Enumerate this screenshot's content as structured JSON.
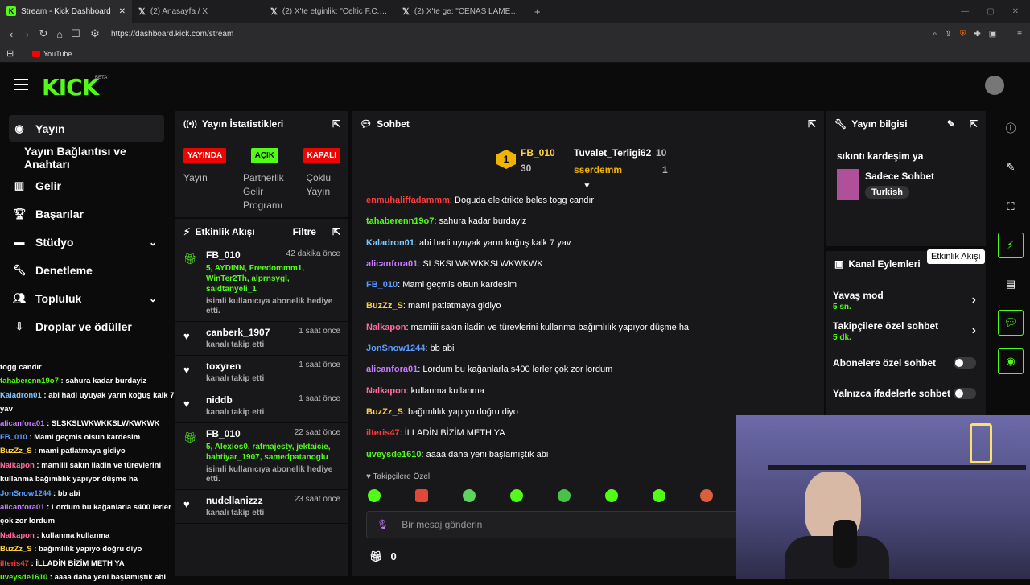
{
  "browser": {
    "tabs": [
      {
        "title": "Stream - Kick Dashboard",
        "icon": "kick-logo-icon"
      },
      {
        "title": "(2) Anasayfa / X",
        "icon": "x-logo-icon"
      },
      {
        "title": "(2) X'te etginlik: \"Celtic F.C. stadyum...",
        "icon": "x-logo-icon"
      },
      {
        "title": "(2) X'te ge: \"CENAS LAMENTAVEIS! P...",
        "icon": "x-logo-icon"
      }
    ],
    "url": "https://dashboard.kick.com/stream",
    "bookmark": "YouTube"
  },
  "app": {
    "logo": "KICK",
    "beta": "BETA"
  },
  "sidebar": {
    "items": [
      {
        "label": "Yayın",
        "icon": "broadcast-icon"
      },
      {
        "label": "Yayın Bağlantısı ve Anahtarı"
      },
      {
        "label": "Gelir",
        "icon": "chart-icon"
      },
      {
        "label": "Başarılar",
        "icon": "trophy-icon"
      },
      {
        "label": "Stüdyo",
        "icon": "studio-icon"
      },
      {
        "label": "Denetleme",
        "icon": "wrench-icon"
      },
      {
        "label": "Topluluk",
        "icon": "community-icon"
      },
      {
        "label": "Droplar ve ödüller",
        "icon": "drops-icon"
      }
    ]
  },
  "overlay_chat": [
    {
      "user": "",
      "text": "togg candır",
      "color": "#ffffff"
    },
    {
      "user": "tahaberenn19o7",
      "text": " : sahura kadar burdayiz",
      "color": "#53fc18"
    },
    {
      "user": "Kaladron01",
      "text": " : abi hadi uyuyak yarın koğuş kalk 7",
      "color": "#7ec8ff"
    },
    {
      "user": "",
      "text": "yav",
      "color": "#ffffff"
    },
    {
      "user": "alicanfora01",
      "text": " : SLSKSLWKWKKSLWKWKWK",
      "color": "#c77dff"
    },
    {
      "user": "FB_010",
      "text": " : Mami geçmis olsun kardesim",
      "color": "#5b9cff"
    },
    {
      "user": "BuzZz_S",
      "text": " : mami patlatmaya gidiyo",
      "color": "#ffd23f"
    },
    {
      "user": "Nalkapon",
      "text": " : mamiiii sakın iladin ve türevlerini",
      "color": "#ff6b9d"
    },
    {
      "user": "",
      "text": "kullanma bağımlılık yapıyor düşme ha",
      "color": "#ffffff"
    },
    {
      "user": "JonSnow1244",
      "text": " : bb abi",
      "color": "#5b9cff"
    },
    {
      "user": "alicanfora01",
      "text": " : Lordum bu kağanlarla s400 lerler",
      "color": "#c77dff"
    },
    {
      "user": "",
      "text": "çok zor lordum",
      "color": "#ffffff"
    },
    {
      "user": "Nalkapon",
      "text": " : kullanma kullanma",
      "color": "#ff6b9d"
    },
    {
      "user": "BuzZz_S",
      "text": " : bağımlılık yapıyo doğru diyo",
      "color": "#ffd23f"
    },
    {
      "user": "ilteris47",
      "text": " : İLLADİN BİZİM METH YA",
      "color": "#ff3b3b"
    },
    {
      "user": "uveysde1610",
      "text": " : aaaa daha yeni başlamıştık abi",
      "color": "#53fc18"
    }
  ],
  "stats": {
    "title": "Yayın İstatistikleri",
    "badges": [
      {
        "text": "YAYINDA",
        "bg": "#eb0400",
        "fg": "#ffffff"
      },
      {
        "text": "AÇIK",
        "bg": "#53fc18",
        "fg": "#000000"
      },
      {
        "text": "KAPALI",
        "bg": "#eb0400",
        "fg": "#ffffff"
      }
    ],
    "labels": [
      "Yayın",
      "Partnerlik Gelir Programı",
      "Çoklu Yayın"
    ]
  },
  "activity": {
    "title": "Etkinlik Akışı",
    "filter": "Filtre",
    "items": [
      {
        "name": "FB_010",
        "time": "42 dakika önce",
        "icon": "gift-icon",
        "green": "5, AYDINN, Freedommm1, WinTer2Th, alprnsygl, saidtanyeli_1",
        "sub": "isimli kullanıcıya abonelik hediye etti."
      },
      {
        "name": "canberk_1907",
        "time": "1 saat önce",
        "icon": "heart-icon",
        "green": "",
        "sub": "kanalı takip etti"
      },
      {
        "name": "toxyren",
        "time": "1 saat önce",
        "icon": "heart-icon",
        "green": "",
        "sub": "kanalı takip etti"
      },
      {
        "name": "niddb",
        "time": "1 saat önce",
        "icon": "heart-icon",
        "green": "",
        "sub": "kanalı takip etti"
      },
      {
        "name": "FB_010",
        "time": "22 saat önce",
        "icon": "gift-icon",
        "green": "5, Alexios0, rafmajesty, jektaicie, bahtiyar_1907, samedpatanoglu",
        "sub": "isimli kullanıcıya abonelik hediye etti."
      },
      {
        "name": "nudellanizzz",
        "time": "23 saat önce",
        "icon": "heart-icon",
        "green": "",
        "sub": "kanalı takip etti"
      }
    ]
  },
  "chat": {
    "title": "Sohbet",
    "leaders": [
      {
        "name": "FB_010",
        "count": "30"
      },
      {
        "name": "Tuvalet_Terligi62",
        "count": "10"
      },
      {
        "name": "sserdemm",
        "count": "1"
      }
    ],
    "messages": [
      {
        "user": "enmuhaliffadammm",
        "text": ": Doguda elektrikte beles togg candır",
        "color": "#ff3b3b"
      },
      {
        "user": "tahaberenn19o7",
        "text": ": sahura kadar burdayiz",
        "color": "#53fc18"
      },
      {
        "user": "Kaladron01",
        "text": ": abi hadi uyuyak yarın koğuş kalk 7 yav",
        "color": "#7ec8ff"
      },
      {
        "user": "alicanfora01",
        "text": ": SLSKSLWKWKKSLWKWKWK",
        "color": "#c77dff"
      },
      {
        "user": "FB_010",
        "text": ": Mami geçmis olsun kardesim",
        "color": "#5b9cff"
      },
      {
        "user": "BuzZz_S",
        "text": ": mami patlatmaya gidiyo",
        "color": "#ffd23f"
      },
      {
        "user": "Nalkapon",
        "text": ": mamiiii sakın iladin ve türevlerini kullanma bağımlılık yapıyor düşme ha",
        "color": "#ff6b9d"
      },
      {
        "user": "JonSnow1244",
        "text": ": bb abi",
        "color": "#5b9cff"
      },
      {
        "user": "alicanfora01",
        "text": ": Lordum bu kağanlarla s400 lerler çok zor lordum",
        "color": "#c77dff"
      },
      {
        "user": "Nalkapon",
        "text": ": kullanma kullanma",
        "color": "#ff6b9d"
      },
      {
        "user": "BuzZz_S",
        "text": ": bağımlılık yapıyo doğru diyo",
        "color": "#ffd23f"
      },
      {
        "user": "ilteris47",
        "text": ": İLLADİN BİZİM METH YA",
        "color": "#ff3b3b"
      },
      {
        "user": "uveysde1610",
        "text": ": aaaa daha yeni başlamıştık abi",
        "color": "#53fc18"
      }
    ],
    "followers_only": "Takipçilere Özel",
    "placeholder": "Bir mesaj gönderin",
    "points": "0"
  },
  "stream_info": {
    "title": "Yayın bilgisi",
    "stream_title": "sıkıntı kardeşim ya",
    "category": "Sadece Sohbet",
    "tag": "Turkish"
  },
  "channel_actions": {
    "title": "Kanal Eylemleri",
    "tooltip": "Etkinlik Akışı",
    "items": [
      {
        "label": "Yavaş mod",
        "value": "5 sn."
      },
      {
        "label": "Takipçilere özel sohbet",
        "value": "5 dk."
      }
    ],
    "toggles": [
      {
        "label": "Abonelere özel sohbet"
      },
      {
        "label": "Yalnızca ifadelerle sohbet"
      }
    ]
  },
  "colors": {
    "accent": "#53fc18",
    "live": "#eb0400",
    "panel": "#18181b"
  }
}
